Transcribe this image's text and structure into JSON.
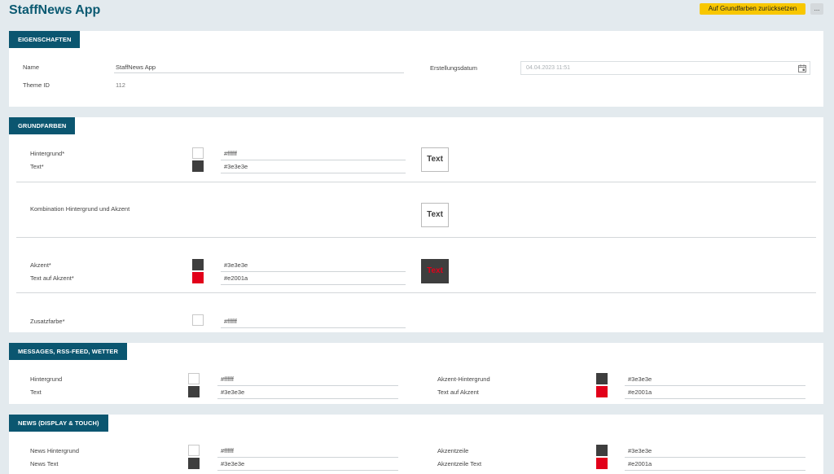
{
  "header": {
    "title": "StaffNews App",
    "reset_label": "Auf Grundfarben zurücksetzen",
    "more_label": "..."
  },
  "eigenschaften": {
    "title": "EIGENSCHAFTEN",
    "name_label": "Name",
    "name_value": "StaffNews App",
    "theme_id_label": "Theme ID",
    "theme_id_value": "112",
    "date_label": "Erstellungsdatum",
    "date_value": "04.04.2023 11:51"
  },
  "grundfarben": {
    "title": "GRUNDFARBEN",
    "hintergrund_label": "Hintergrund*",
    "hintergrund_value": "#ffffff",
    "text_label": "Text*",
    "text_value": "#3e3e3e",
    "kombination_label": "Kombination Hintergrund und Akzent",
    "akzent_label": "Akzent*",
    "akzent_value": "#3e3e3e",
    "text_auf_akzent_label": "Text auf Akzent*",
    "text_auf_akzent_value": "#e2001a",
    "zusatz_label": "Zusatzfarbe*",
    "zusatz_value": "#ffffff",
    "preview_text": "Text"
  },
  "messages": {
    "title": "MESSAGES, RSS-FEED, WETTER",
    "hintergrund_label": "Hintergrund",
    "hintergrund_value": "#ffffff",
    "text_label": "Text",
    "text_value": "#3e3e3e",
    "akzent_hg_label": "Akzent-Hintergrund",
    "akzent_hg_value": "#3e3e3e",
    "text_auf_akzent_label": "Text auf Akzent",
    "text_auf_akzent_value": "#e2001a"
  },
  "news": {
    "title": "NEWS (DISPLAY & TOUCH)",
    "hintergrund_label": "News Hintergrund",
    "hintergrund_value": "#ffffff",
    "text_label": "News Text",
    "text_value": "#3e3e3e",
    "akzentzeile_label": "Akzentzeile",
    "akzentzeile_value": "#3e3e3e",
    "akzentzeile_text_label": "Akzentzeile Text",
    "akzentzeile_text_value": "#e2001a"
  },
  "colors": {
    "brand": "#0b5670",
    "accent_button": "#f8c700",
    "white": "#ffffff",
    "dark": "#3e3e3e",
    "red": "#e2001a"
  },
  "icons": {
    "calendar": "calendar-icon"
  }
}
